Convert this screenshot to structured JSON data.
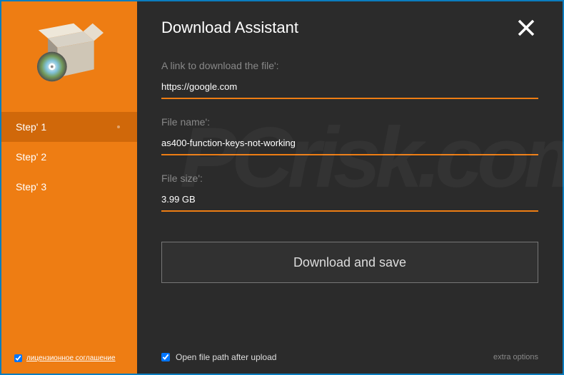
{
  "sidebar": {
    "steps": [
      {
        "label": "Step' 1",
        "active": true
      },
      {
        "label": "Step' 2",
        "active": false
      },
      {
        "label": "Step' 3",
        "active": false
      }
    ],
    "license": {
      "checked": true,
      "label": "лицензионное соглашение"
    }
  },
  "header": {
    "title": "Download Assistant"
  },
  "fields": {
    "link": {
      "label": "A link to download the file':",
      "value": "https://google.com"
    },
    "filename": {
      "label": "File name':",
      "value": "as400-function-keys-not-working"
    },
    "filesize": {
      "label": "File size':",
      "value": "3.99 GB"
    }
  },
  "download_button": "Download and save",
  "bottom": {
    "open_path_checked": true,
    "open_path_label": "Open file path after upload",
    "extra": "extra options"
  }
}
